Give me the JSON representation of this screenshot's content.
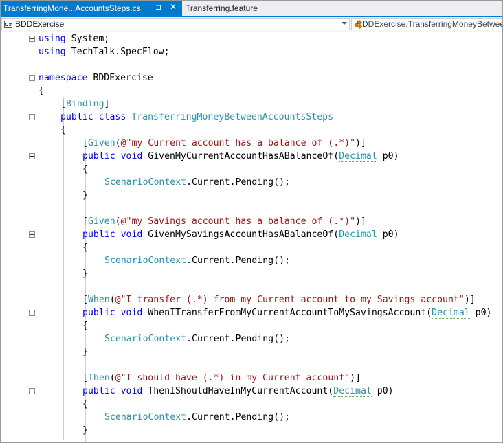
{
  "tabs": [
    {
      "label": "TransferringMone...AccountsSteps.cs",
      "active": true
    },
    {
      "label": "Transferring.feature",
      "active": false
    }
  ],
  "tab_icons": {
    "pin": "pin-icon",
    "close": "close-icon"
  },
  "navbar": {
    "project_combo": "BDDExercise",
    "member_combo": "BDDExercise.TransferringMoneyBetweenAccountsSteps"
  },
  "colors": {
    "accent": "#007acc",
    "keyword": "#0000ff",
    "type": "#2b91af",
    "string": "#a31515",
    "text": "#000000"
  },
  "code": {
    "line1": [
      "using",
      " System;"
    ],
    "line2": [
      "using",
      " TechTalk.SpecFlow;"
    ],
    "line4": [
      "namespace",
      " BDDExercise"
    ],
    "line5": "{",
    "line6": [
      "[",
      "Binding",
      "]"
    ],
    "line7": [
      "public",
      " ",
      "class",
      " ",
      "TransferringMoneyBetweenAccountsSteps"
    ],
    "line8": "{",
    "given1": {
      "attr": [
        "[",
        "Given",
        "(",
        "@\"my Current account has a balance of (.*)\"",
        ")]"
      ],
      "sig": [
        "public",
        " ",
        "void",
        " GivenMyCurrentAccountHasABalanceOf(",
        "Decimal",
        " p0)"
      ],
      "open": "{",
      "body": [
        "ScenarioContext",
        ".Current.Pending();"
      ],
      "close": "}"
    },
    "given2": {
      "attr": [
        "[",
        "Given",
        "(",
        "@\"my Savings account has a balance of (.*)\"",
        ")]"
      ],
      "sig": [
        "public",
        " ",
        "void",
        " GivenMySavingsAccountHasABalanceOf(",
        "Decimal",
        " p0)"
      ],
      "open": "{",
      "body": [
        "ScenarioContext",
        ".Current.Pending();"
      ],
      "close": "}"
    },
    "when1": {
      "attr": [
        "[",
        "When",
        "(",
        "@\"I transfer (.*) from my Current account to my Savings account\"",
        ")]"
      ],
      "sig": [
        "public",
        " ",
        "void",
        " WhenITransferFromMyCurrentAccountToMySavingsAccount(",
        "Decimal",
        " p0)"
      ],
      "open": "{",
      "body": [
        "ScenarioContext",
        ".Current.Pending();"
      ],
      "close": "}"
    },
    "then1": {
      "attr": [
        "[",
        "Then",
        "(",
        "@\"I should have (.*) in my Current account\"",
        ")]"
      ],
      "sig": [
        "public",
        " ",
        "void",
        " ThenIShouldHaveInMyCurrentAccount(",
        "Decimal",
        " p0)"
      ],
      "open": "{",
      "body": [
        "ScenarioContext",
        ".Current.Pending();"
      ],
      "close": "}"
    }
  }
}
